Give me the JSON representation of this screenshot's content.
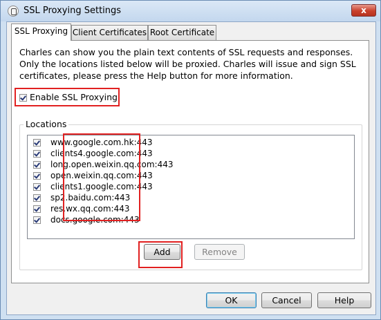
{
  "window": {
    "title": "SSL Proxying Settings",
    "close_symbol": "x"
  },
  "tabs": [
    {
      "label": "SSL Proxying",
      "active": true
    },
    {
      "label": "Client Certificates",
      "active": false
    },
    {
      "label": "Root Certificate",
      "active": false
    }
  ],
  "description": "Charles can show you the plain text contents of SSL requests and responses. Only the locations listed below will be proxied. Charles will issue and sign SSL certificates, please press the Help button for more information.",
  "enable_ssl_proxying": {
    "label": "Enable SSL Proxying",
    "checked": true
  },
  "locations": {
    "label": "Locations",
    "items": [
      {
        "host": "www.google.com.hk:443",
        "checked": true
      },
      {
        "host": "clients4.google.com:443",
        "checked": true
      },
      {
        "host": "long.open.weixin.qq.com:443",
        "checked": true
      },
      {
        "host": "open.weixin.qq.com:443",
        "checked": true
      },
      {
        "host": "clients1.google.com:443",
        "checked": true
      },
      {
        "host": "sp2.baidu.com:443",
        "checked": true
      },
      {
        "host": "res.wx.qq.com:443",
        "checked": true
      },
      {
        "host": "docs.google.com:443",
        "checked": true
      }
    ]
  },
  "buttons": {
    "add": "Add",
    "remove": "Remove",
    "ok": "OK",
    "cancel": "Cancel",
    "help": "Help"
  },
  "colors": {
    "highlight_box": "#e12020",
    "window_frame": "#cfe0f1",
    "close_button": "#c9402c"
  }
}
